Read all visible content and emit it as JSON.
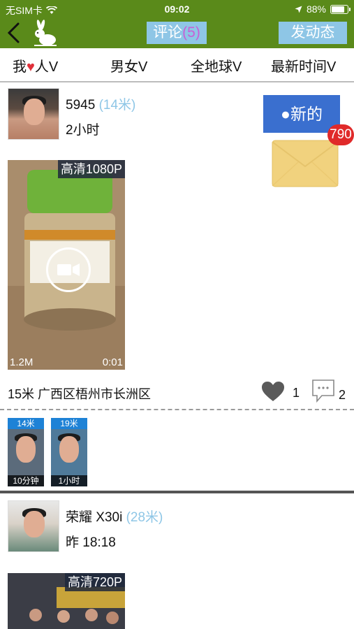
{
  "status_bar": {
    "carrier": "无SIM卡",
    "time": "09:02",
    "battery": "88%",
    "battery_level": 0.88
  },
  "nav": {
    "comments_label": "评论",
    "comments_count": "(5)",
    "post_label": "发动态"
  },
  "filters": {
    "f1_a": "我",
    "f1_b": "人V",
    "f2": "男女V",
    "f3": "全地球V",
    "f4": "最新时间V"
  },
  "posts": [
    {
      "username": "5945",
      "distance": "(14米)",
      "time": "2小时",
      "video": {
        "hd": "高清1080P",
        "size": "1.2M",
        "duration": "0:01"
      },
      "location": "15米 广西区梧州市长洲区",
      "likes": "1",
      "comments": "2",
      "visitors": [
        {
          "distance": "14米",
          "time": "10分钟"
        },
        {
          "distance": "19米",
          "time": "1小时"
        }
      ]
    },
    {
      "username": "荣耀 X30i",
      "distance": "(28米)",
      "time": "昨 18:18",
      "video": {
        "hd": "高清720P"
      }
    }
  ],
  "floating": {
    "new_label": "●新的",
    "mail_count": "790"
  },
  "colors": {
    "nav_green": "#5a8a1a",
    "tab_blue": "#8ec6e6",
    "count_purple": "#c85fd6",
    "new_blue": "#3a6fcf",
    "badge_red": "#e02a2a"
  }
}
